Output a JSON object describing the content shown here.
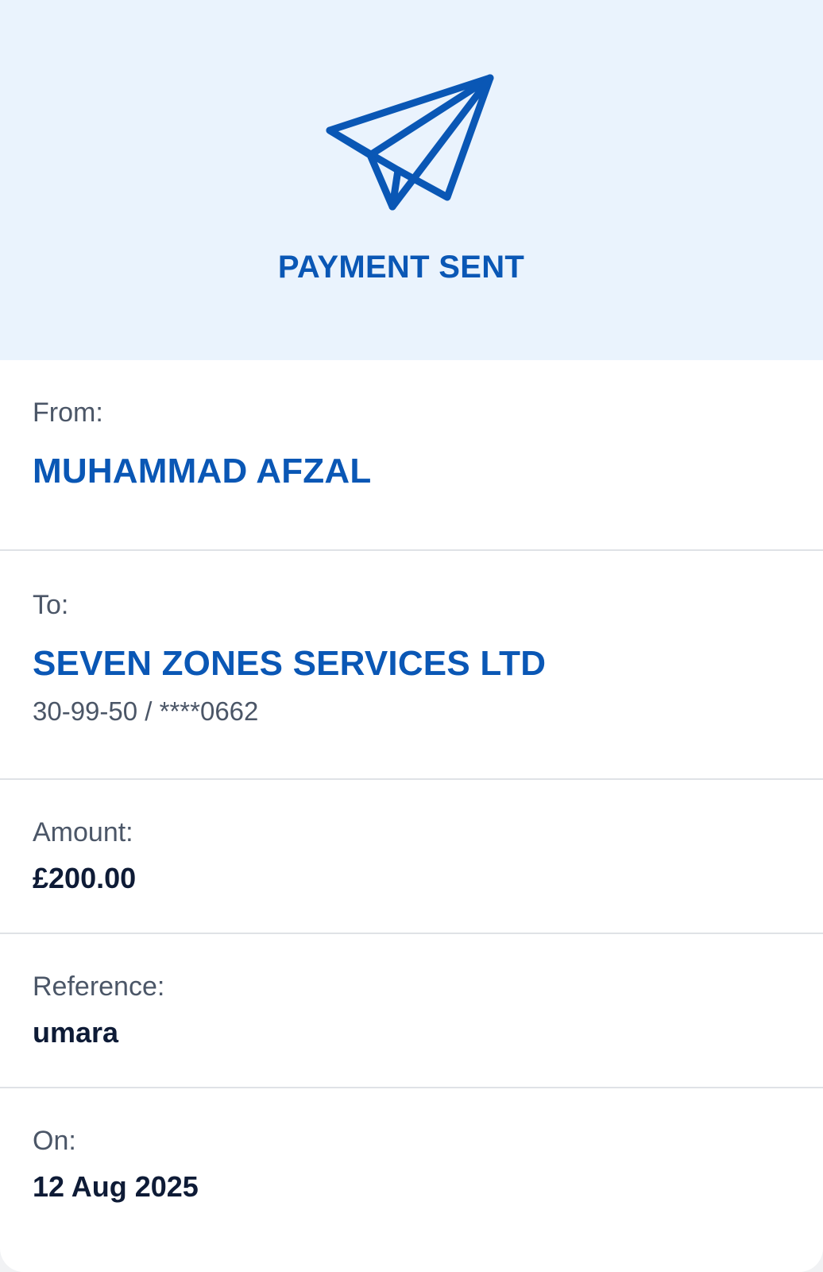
{
  "header": {
    "icon": "paper-plane-icon",
    "title": "PAYMENT SENT",
    "accent_color": "#0a57b5",
    "background_color": "#eaf3fd"
  },
  "from": {
    "label": "From:",
    "name": "MUHAMMAD AFZAL"
  },
  "to": {
    "label": "To:",
    "name": "SEVEN ZONES SERVICES LTD",
    "account": "30-99-50 / ****0662"
  },
  "amount": {
    "label": "Amount:",
    "value": "£200.00"
  },
  "reference": {
    "label": "Reference:",
    "value": "umara"
  },
  "date": {
    "label": "On:",
    "value": "12 Aug 2025"
  }
}
